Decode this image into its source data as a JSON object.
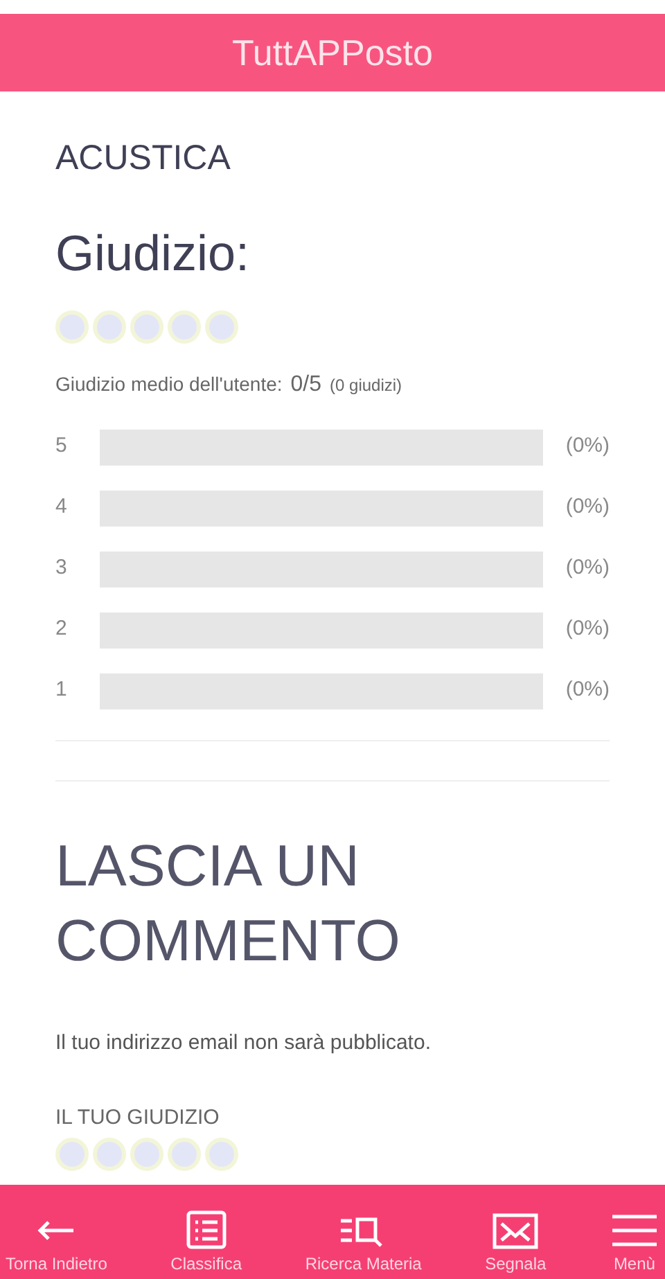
{
  "header": {
    "title": "TuttAPPosto"
  },
  "section": {
    "title": "ACUSTICA"
  },
  "rating": {
    "title": "Giudizio:",
    "stars": 0,
    "summary_label": "Giudizio medio dell'utente:",
    "summary_value": "0/5",
    "summary_count": "(0 giudizi)"
  },
  "breakdown": [
    {
      "label": "5",
      "percent": "(0%)"
    },
    {
      "label": "4",
      "percent": "(0%)"
    },
    {
      "label": "3",
      "percent": "(0%)"
    },
    {
      "label": "2",
      "percent": "(0%)"
    },
    {
      "label": "1",
      "percent": "(0%)"
    }
  ],
  "comment": {
    "title": "LASCIA UN COMMENTO",
    "note": "Il tuo indirizzo email non sarà pubblicato.",
    "rating_label": "IL TUO GIUDIZIO",
    "stars": 0
  },
  "bottom_nav": [
    {
      "kind": "back",
      "label": "Torna Indietro"
    },
    {
      "kind": "list",
      "label": "Classifica"
    },
    {
      "kind": "search",
      "label": "Ricerca Materia"
    },
    {
      "kind": "mail",
      "label": "Segnala"
    },
    {
      "kind": "menu",
      "label": "Menù"
    }
  ]
}
